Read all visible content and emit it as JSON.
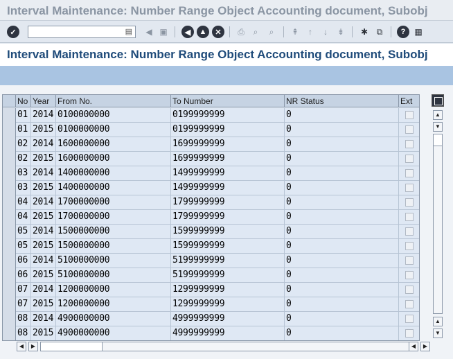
{
  "window": {
    "title": "Interval Maintenance: Number Range Object Accounting document, Subobj"
  },
  "toolbar": {
    "command_field": {
      "value": "",
      "placeholder": ""
    },
    "icons": [
      "check-icon",
      "back-icon",
      "save-icon",
      "back-nav-icon",
      "exit-icon",
      "cancel-icon",
      "print-icon",
      "find-icon",
      "find-next-icon",
      "first-page-icon",
      "prev-page-icon",
      "next-page-icon",
      "last-page-icon",
      "new-session-icon",
      "shortcut-icon",
      "help-icon",
      "customize-layout-icon"
    ]
  },
  "screen": {
    "heading": "Interval Maintenance: Number Range Object Accounting document, Subobj"
  },
  "table": {
    "columns": [
      "No",
      "Year",
      "From No.",
      "To Number",
      "NR Status",
      "Ext"
    ],
    "rows": [
      {
        "no": "01",
        "year": "2014",
        "from": "0100000000",
        "to": "0199999999",
        "status": "0",
        "ext": false
      },
      {
        "no": "01",
        "year": "2015",
        "from": "0100000000",
        "to": "0199999999",
        "status": "0",
        "ext": false
      },
      {
        "no": "02",
        "year": "2014",
        "from": "1600000000",
        "to": "1699999999",
        "status": "0",
        "ext": false
      },
      {
        "no": "02",
        "year": "2015",
        "from": "1600000000",
        "to": "1699999999",
        "status": "0",
        "ext": false
      },
      {
        "no": "03",
        "year": "2014",
        "from": "1400000000",
        "to": "1499999999",
        "status": "0",
        "ext": false
      },
      {
        "no": "03",
        "year": "2015",
        "from": "1400000000",
        "to": "1499999999",
        "status": "0",
        "ext": false
      },
      {
        "no": "04",
        "year": "2014",
        "from": "1700000000",
        "to": "1799999999",
        "status": "0",
        "ext": false
      },
      {
        "no": "04",
        "year": "2015",
        "from": "1700000000",
        "to": "1799999999",
        "status": "0",
        "ext": false
      },
      {
        "no": "05",
        "year": "2014",
        "from": "1500000000",
        "to": "1599999999",
        "status": "0",
        "ext": false
      },
      {
        "no": "05",
        "year": "2015",
        "from": "1500000000",
        "to": "1599999999",
        "status": "0",
        "ext": false
      },
      {
        "no": "06",
        "year": "2014",
        "from": "5100000000",
        "to": "5199999999",
        "status": "0",
        "ext": false
      },
      {
        "no": "06",
        "year": "2015",
        "from": "5100000000",
        "to": "5199999999",
        "status": "0",
        "ext": false
      },
      {
        "no": "07",
        "year": "2014",
        "from": "1200000000",
        "to": "1299999999",
        "status": "0",
        "ext": false
      },
      {
        "no": "07",
        "year": "2015",
        "from": "1200000000",
        "to": "1299999999",
        "status": "0",
        "ext": false
      },
      {
        "no": "08",
        "year": "2014",
        "from": "4900000000",
        "to": "4999999999",
        "status": "0",
        "ext": false
      },
      {
        "no": "08",
        "year": "2015",
        "from": "4900000000",
        "to": "4999999999",
        "status": "0",
        "ext": false
      }
    ]
  },
  "colors": {
    "header_bg": "#c6d3e3",
    "row_bg": "#dfe8f4",
    "heading_text": "#1f4b7a",
    "band": "#a9c4e2"
  }
}
